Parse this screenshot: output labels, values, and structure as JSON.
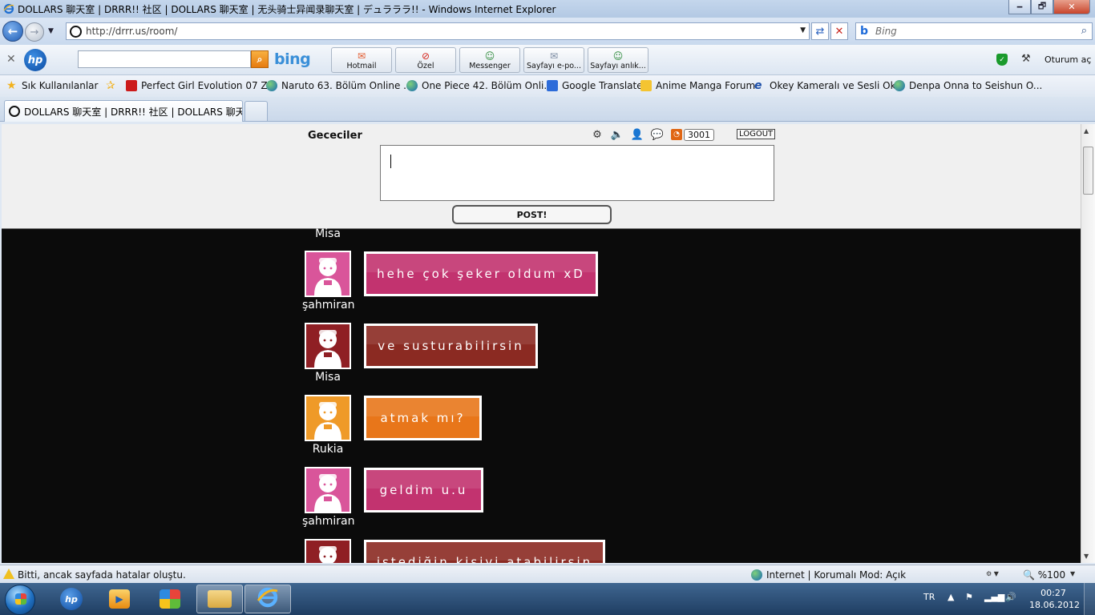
{
  "window": {
    "title": "DOLLARS 聊天室 | DRRR!! 社区 | DOLLARS 聊天室 | 无头骑士异闻录聊天室 | デュラララ!! - Windows Internet Explorer",
    "minimize": "🗕",
    "maximize": "🗗",
    "close": "✕"
  },
  "nav": {
    "back": "←",
    "forward": "→",
    "address": "http://drrr.us/room/",
    "search_placeholder": "Bing",
    "refresh": "⇄",
    "stop": "✕"
  },
  "hp_toolbar": {
    "bing": "bing",
    "buttons": [
      {
        "label": "Hotmail",
        "icon": "✉"
      },
      {
        "label": "Özel",
        "icon": "⊘"
      },
      {
        "label": "Messenger",
        "icon": "☺"
      },
      {
        "label": "Sayfayı e-po...",
        "icon": "✉"
      },
      {
        "label": "Sayfayı anlık...",
        "icon": "☺"
      }
    ],
    "signin": "Oturum aç"
  },
  "favorites": {
    "label": "Sık Kullanılanlar",
    "items": [
      {
        "label": "Perfect Girl Evolution 07 Z...",
        "color": "#cc1b1b"
      },
      {
        "label": "Naruto 63. Bölüm Online ...",
        "color": "globe"
      },
      {
        "label": "One Piece 42. Bölüm Onli...",
        "color": "globe"
      },
      {
        "label": "Google Translate",
        "color": "#2c6bd9"
      },
      {
        "label": "Anime Manga Forum",
        "color": "#f4c431"
      },
      {
        "label": "Okey  Kameralı ve Sesli Ok...",
        "color": "#1d4fa8"
      },
      {
        "label": "Denpa Onna to Seishun O...",
        "color": "globe"
      }
    ]
  },
  "tab": {
    "label": "DOLLARS 聊天室 | DRRR!! 社区 | DOLLARS 聊天室..."
  },
  "room": {
    "name": "Gececiler",
    "counter": "3001",
    "logout": "LOGOUT",
    "post": "POST!",
    "top_user": "Misa"
  },
  "messages": [
    {
      "user": "şahmiran",
      "text": "hehe çok şeker oldum xD",
      "color": "#c2336f",
      "avatar_color": "#d9559a"
    },
    {
      "user": "Misa",
      "text": "ve susturabilirsin",
      "color": "#8b2a22",
      "avatar_color": "#8f1f24"
    },
    {
      "user": "Rukia",
      "text": "atmak mı?",
      "color": "#e8761a",
      "avatar_color": "#ef9a28"
    },
    {
      "user": "şahmiran",
      "text": "geldim u.u",
      "color": "#c2336f",
      "avatar_color": "#d9559a"
    },
    {
      "user": "",
      "text": "istediğin kişiyi atabilirsin",
      "color": "#8b2a22",
      "avatar_color": "#8f1f24"
    }
  ],
  "status": {
    "text": "Bitti, ancak sayfada hatalar oluştu.",
    "zone": "Internet | Korumalı Mod: Açık",
    "zoom": "%100"
  },
  "taskbar": {
    "lang": "TR",
    "time": "00:27",
    "date": "18.06.2012"
  }
}
